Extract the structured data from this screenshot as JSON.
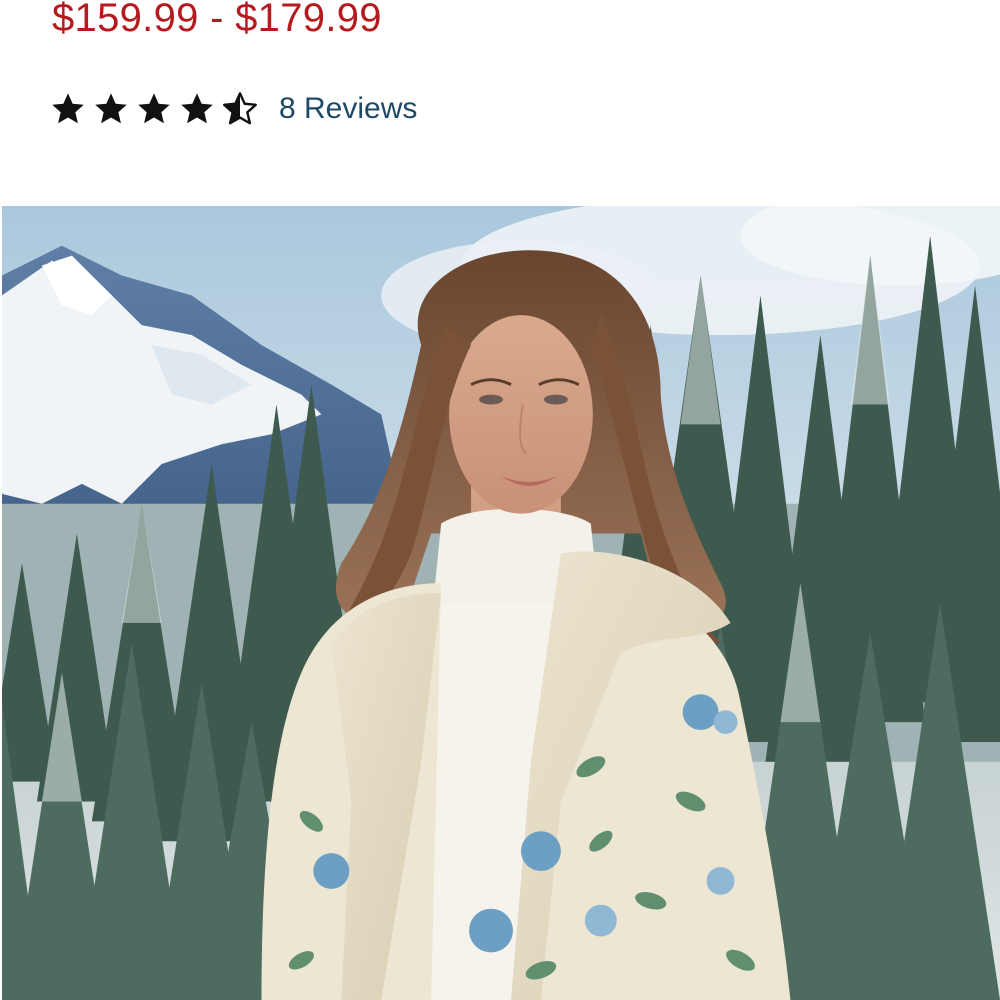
{
  "product": {
    "price_range": "$159.99 - $179.99",
    "rating": 4.5,
    "rating_max": 5,
    "reviews_link": "8 Reviews"
  },
  "hero_image": {
    "alt": "Woman wearing a cream floral jacket with faux fur collar and white turtleneck in a snowy mountain forest"
  },
  "colors": {
    "price": "#b51a1f",
    "link": "#1e4a66",
    "star": "#111111"
  },
  "icons": {
    "full_star": "star-icon",
    "half_star": "half-star-icon"
  }
}
